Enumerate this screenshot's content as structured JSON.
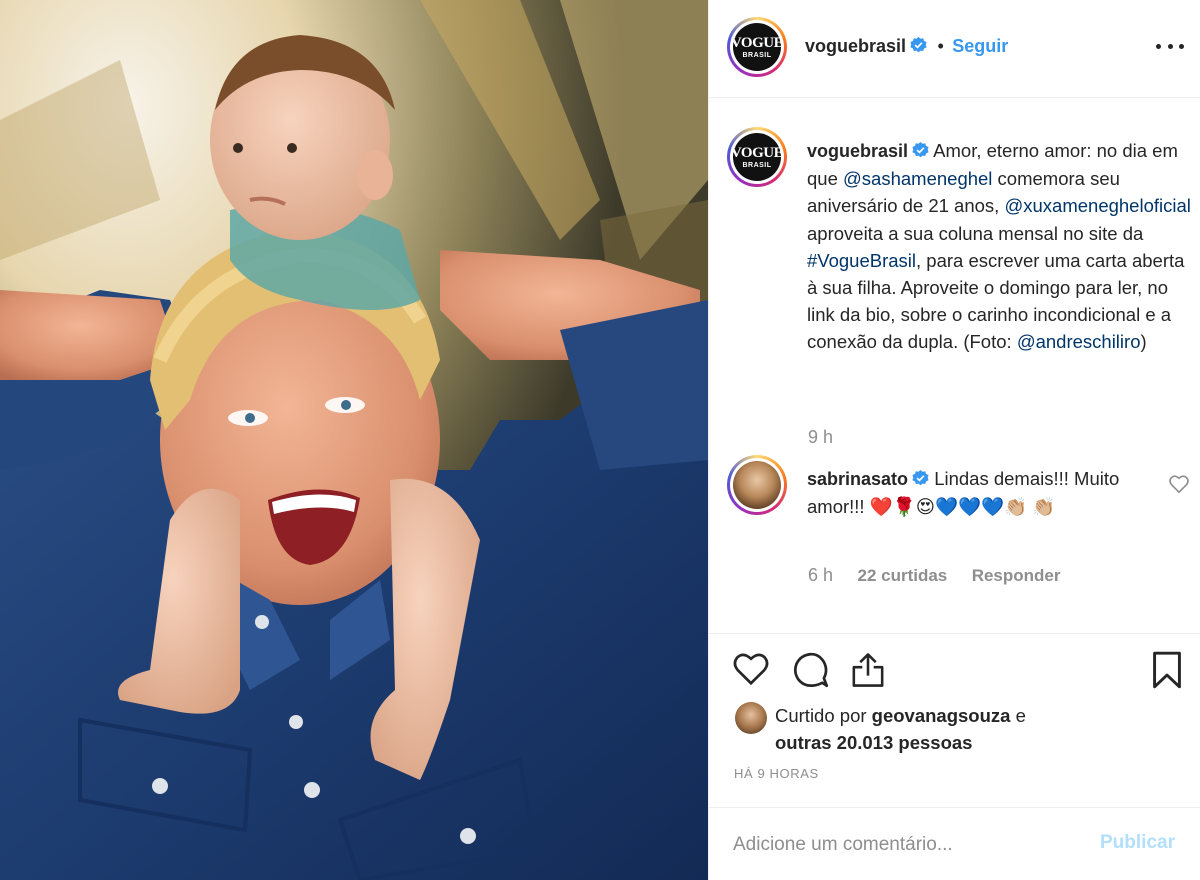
{
  "post": {
    "author": "voguebrasil",
    "follow_label": "Seguir",
    "separator": "•",
    "avatar_logo_top": "VOGUE",
    "avatar_logo_bottom": "BRASIL"
  },
  "caption": {
    "author": "voguebrasil",
    "text_1": "Amor, eterno amor: no dia em que ",
    "mention_1": "@sashameneghel",
    "text_2": " comemora seu aniversário de 21 anos, ",
    "mention_2": "@xuxameneghel​oficial",
    "text_3": " aproveita a sua coluna mensal no site da ",
    "hashtag": "#VogueBrasil",
    "text_4": ", para escrever uma carta aberta à sua filha. Aproveite o domingo para ler, no link da bio, sobre o carinho incondicional e a conexão da dupla. (Foto: ",
    "mention_3": "@andreschiliro",
    "text_5": ")",
    "time": "9 h"
  },
  "comment": {
    "author": "sabrinasato",
    "text": "Lindas demais!!! Muito amor!!! ❤️🌹😍💙💙💙👏🏼 👏🏼",
    "time": "6 h",
    "likes": "22 curtidas",
    "reply_label": "Responder"
  },
  "likes": {
    "prefix": "Curtido por ",
    "user": "geovanagsouza",
    "middle": " e",
    "others": "outras 20.013 pessoas"
  },
  "timestamp": "HÁ 9 HORAS",
  "add_comment": {
    "placeholder": "Adicione um comentário...",
    "publish_label": "Publicar"
  },
  "icons": {
    "like": "heart-icon",
    "comment": "comment-icon",
    "share": "share-icon",
    "save": "bookmark-icon",
    "more": "more-options-icon",
    "verified": "verified-badge-icon"
  },
  "colors": {
    "link_blue": "#3897f0",
    "mention_blue": "#003569",
    "muted": "#8e8e8e",
    "publish_disabled": "#b2dffc",
    "verified": "#3897f0"
  }
}
